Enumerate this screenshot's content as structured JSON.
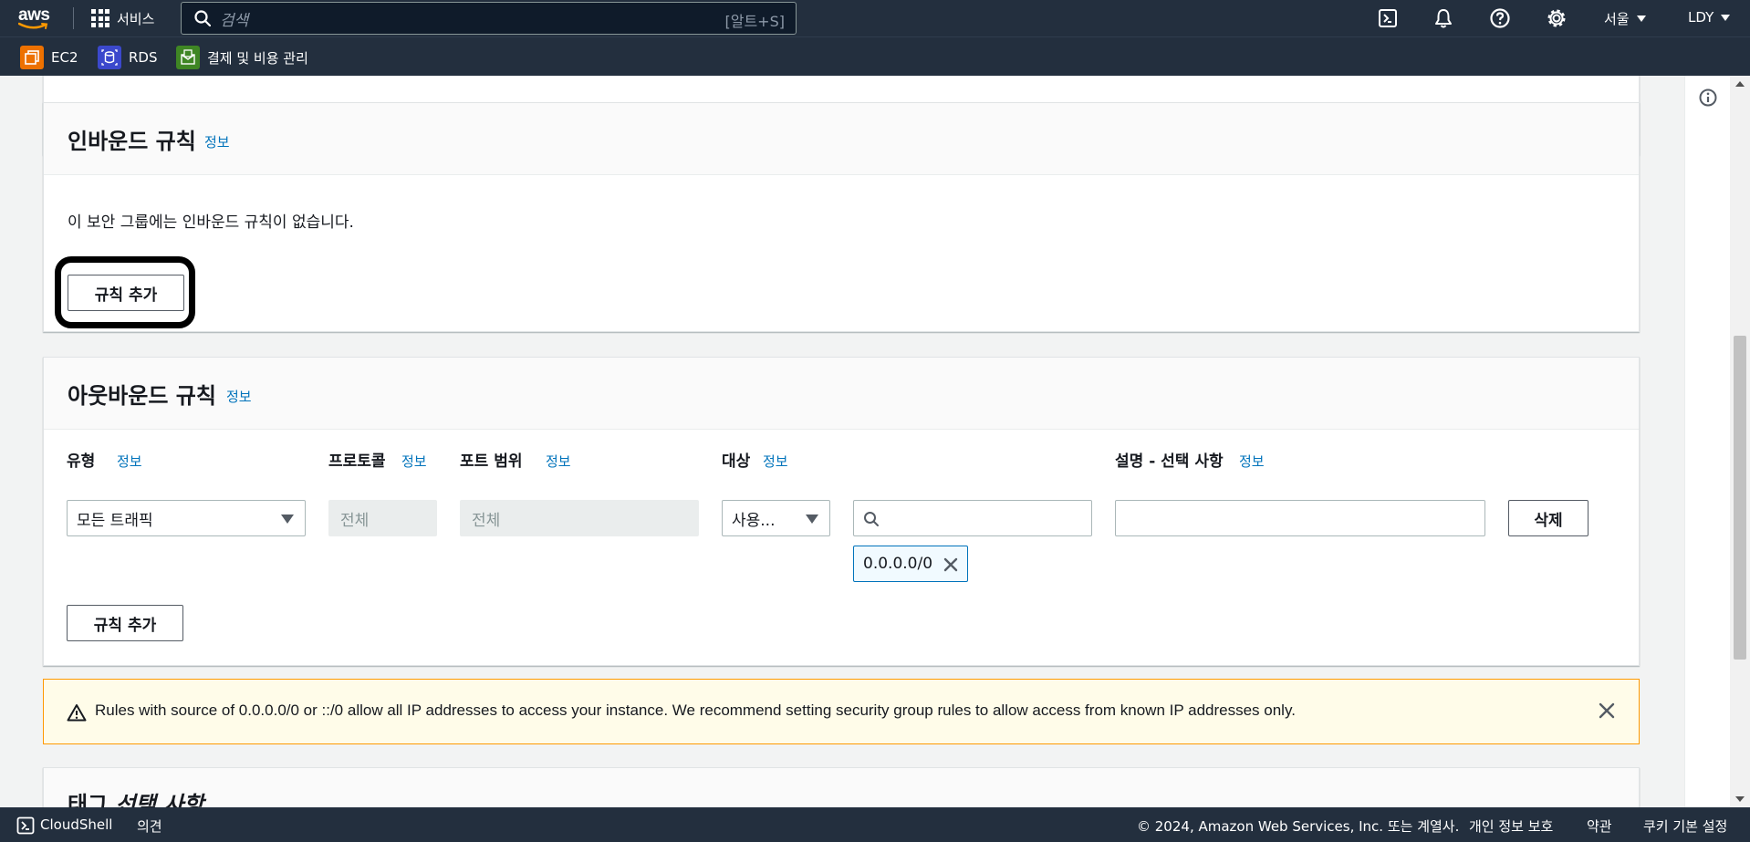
{
  "nav": {
    "logo": "aws",
    "services": "서비스",
    "search_placeholder": "검색",
    "search_shortcut": "[알트+S]",
    "region": "서울",
    "account": "LDY"
  },
  "favorites": [
    {
      "label": "EC2",
      "color": "#ed7100"
    },
    {
      "label": "RDS",
      "color": "#3b48cc"
    },
    {
      "label": "결제 및 비용 관리",
      "color": "#3f8624"
    }
  ],
  "inbound": {
    "title": "인바운드 규칙",
    "info": "정보",
    "empty_text": "이 보안 그룹에는 인바운드 규칙이 없습니다.",
    "add_button": "규칙 추가"
  },
  "outbound": {
    "title": "아웃바운드 규칙",
    "info": "정보",
    "columns": [
      {
        "label": "유형",
        "info": "정보"
      },
      {
        "label": "프로토콜",
        "info": "정보"
      },
      {
        "label": "포트 범위",
        "info": "정보"
      },
      {
        "label": "대상",
        "info": "정보"
      },
      {
        "label": "설명 - 선택 사항",
        "info": "정보"
      }
    ],
    "type_value": "모든 트래픽",
    "protocol_value": "전체",
    "port_value": "전체",
    "dest_value": "사용...",
    "token": "0.0.0.0/0",
    "delete_button": "삭제",
    "add_button": "규칙 추가"
  },
  "alert": {
    "message": "Rules with source of 0.0.0.0/0 or ::/0 allow all IP addresses to access your instance. We recommend setting security group rules to allow access from known IP addresses only."
  },
  "tags": {
    "title": "태그",
    "optional": "선택 사항"
  },
  "footer": {
    "cloudshell": "CloudShell",
    "feedback": "의견",
    "copyright": "© 2024, Amazon Web Services, Inc. 또는 계열사.",
    "privacy": "개인 정보 보호",
    "terms": "약관",
    "cookies": "쿠키 기본 설정"
  },
  "colors": {
    "nav_bg": "#232f3e",
    "link": "#0073bb",
    "warning_border": "#ff9900",
    "warning_bg": "#fffce9"
  }
}
